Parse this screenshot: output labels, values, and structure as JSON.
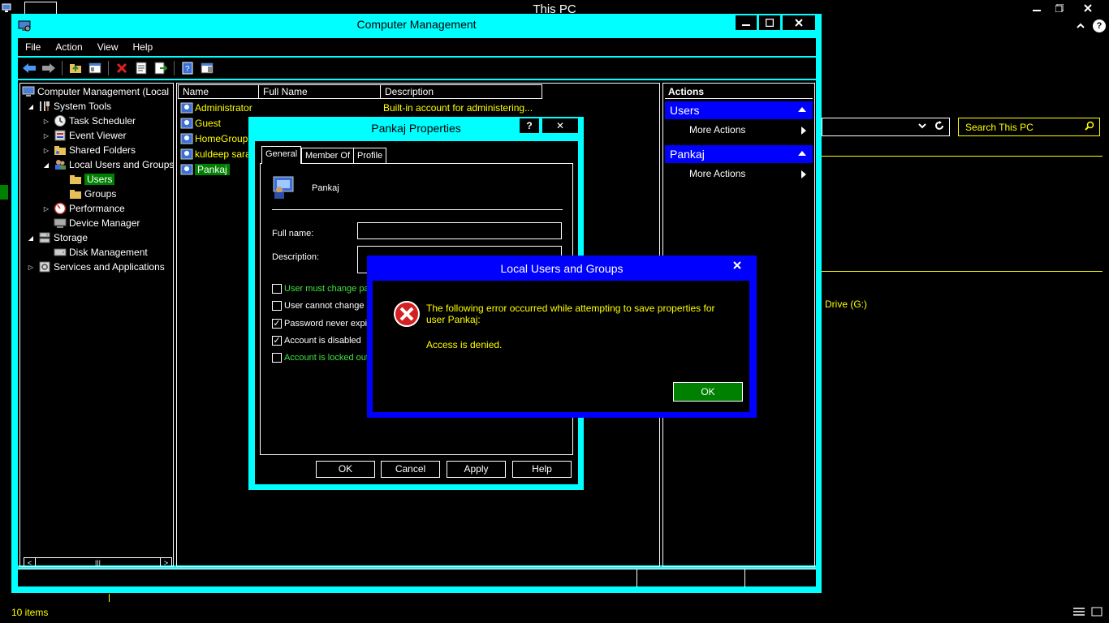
{
  "background_window": {
    "title": "This PC",
    "search_placeholder": "Search This PC",
    "drive_label": "Drive (G:)",
    "status_items": "10 items"
  },
  "cm": {
    "title": "Computer Management",
    "menu": [
      "File",
      "Action",
      "View",
      "Help"
    ],
    "tree": {
      "root": "Computer Management (Local",
      "system_tools": "System Tools",
      "task_scheduler": "Task Scheduler",
      "event_viewer": "Event Viewer",
      "shared_folders": "Shared Folders",
      "local_users_groups": "Local Users and Groups",
      "users": "Users",
      "groups": "Groups",
      "performance": "Performance",
      "device_manager": "Device Manager",
      "storage": "Storage",
      "disk_management": "Disk Management",
      "services_apps": "Services and Applications"
    },
    "list": {
      "columns": [
        "Name",
        "Full Name",
        "Description"
      ],
      "rows": [
        {
          "name": "Administrator",
          "description": "Built-in account for administering..."
        },
        {
          "name": "Guest",
          "description": ""
        },
        {
          "name": "HomeGroup...",
          "description": ""
        },
        {
          "name": "kuldeep saran",
          "description": ""
        },
        {
          "name": "Pankaj",
          "description": ""
        }
      ]
    },
    "actions": {
      "header": "Actions",
      "section1": "Users",
      "section1_more": "More Actions",
      "section2": "Pankaj",
      "section2_more": "More Actions"
    }
  },
  "props": {
    "title": "Pankaj Properties",
    "help_btn": "?",
    "close_btn": "✕",
    "tabs": [
      "General",
      "Member Of",
      "Profile"
    ],
    "user_name": "Pankaj",
    "full_name_label": "Full name:",
    "description_label": "Description:",
    "checkboxes": [
      {
        "label": "User must change pa",
        "checked": false
      },
      {
        "label": "User cannot change p",
        "checked": false
      },
      {
        "label": "Password never expir",
        "checked": true
      },
      {
        "label": "Account is disabled",
        "checked": true
      },
      {
        "label": "Account is locked out",
        "checked": false
      }
    ],
    "buttons": {
      "ok": "OK",
      "cancel": "Cancel",
      "apply": "Apply",
      "help": "Help"
    }
  },
  "error": {
    "title": "Local Users and Groups",
    "message": "The following error occurred while attempting to save properties for user Pankaj:",
    "detail": "Access is denied.",
    "ok": "OK"
  },
  "colors": {
    "accent_cyan": "#00ffff",
    "accent_blue": "#0000ff",
    "selection_green": "#008000",
    "text_yellow": "#ffff00"
  }
}
